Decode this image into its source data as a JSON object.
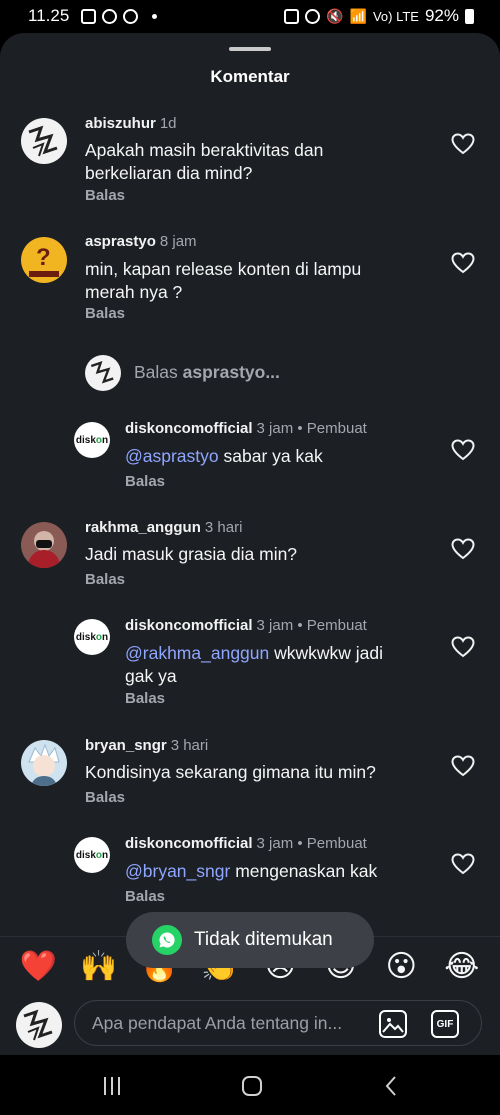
{
  "status_bar": {
    "time": "11.25",
    "network_label": "Vo) LTE",
    "battery": "92%"
  },
  "sheet": {
    "title": "Komentar"
  },
  "comments": [
    {
      "user": "abiszuhur",
      "time": "1d",
      "text": "Apakah masih beraktivitas dan berkeliaran dia mind?",
      "reply": "Balas"
    },
    {
      "user": "asprastyo",
      "time": "8 jam",
      "text": "min, kapan release konten di lampu merah nya ?",
      "reply": "Balas"
    },
    {
      "user": "diskoncomofficial",
      "time": "3 jam • Pembuat",
      "mention": "@asprastyo",
      "text": " sabar ya kak",
      "reply": "Balas"
    },
    {
      "user": "rakhma_anggun",
      "time": "3 hari",
      "text": "Jadi masuk grasia dia min?",
      "reply": "Balas"
    },
    {
      "user": "diskoncomofficial",
      "time": "3 jam • Pembuat",
      "mention": "@rakhma_anggun",
      "text": " wkwkwkw jadi gak ya",
      "reply": "Balas"
    },
    {
      "user": "bryan_sngr",
      "time": "3 hari",
      "text": "Kondisinya sekarang gimana itu min?",
      "reply": "Balas"
    },
    {
      "user": "diskoncomofficial",
      "time": "3 jam • Pembuat",
      "mention": "@bryan_sngr",
      "text": " mengenaskan kak",
      "reply": "Balas"
    }
  ],
  "reply_prompt": {
    "prefix": "Balas ",
    "user": "asprastyo..."
  },
  "avatar_logo": {
    "prefix": "disk",
    "o": "o",
    "suffix": "n"
  },
  "toast": {
    "text": "Tidak ditemukan",
    "icon": "whatsapp-icon",
    "color": "#25d366"
  },
  "emojis": [
    "❤️",
    "🙌",
    "🔥",
    "👏",
    "😢",
    "😍",
    "😮",
    "😂"
  ],
  "input": {
    "placeholder": "Apa pendapat Anda tentang in...",
    "gif_label": "GIF"
  },
  "colors": {
    "sheet_bg": "#1c1f24",
    "mention": "#8fa6ff",
    "secondary_text": "#a3a7ad"
  }
}
